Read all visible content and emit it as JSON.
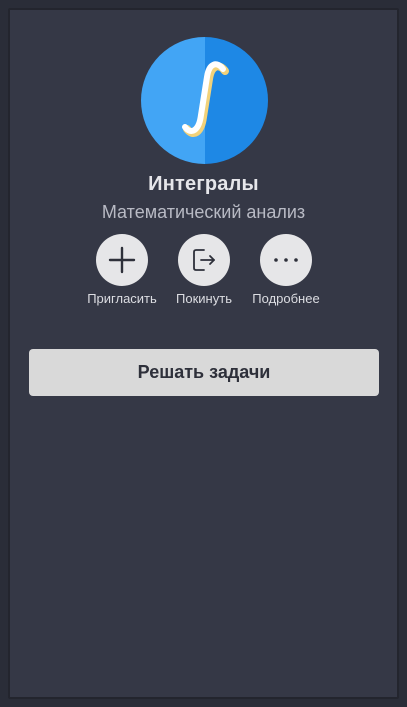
{
  "course": {
    "title": "Интегралы",
    "subtitle": "Математический анализ",
    "logo_icon": "integral-icon",
    "logo_colors": {
      "light": "#42a5f5",
      "dark": "#1e88e5",
      "symbol": "#ffffff",
      "symbol_shadow": "#f2d27a"
    }
  },
  "actions": [
    {
      "label": "Пригласить",
      "icon": "plus-icon"
    },
    {
      "label": "Покинуть",
      "icon": "exit-icon"
    },
    {
      "label": "Подробнее",
      "icon": "more-dots-icon"
    }
  ],
  "primary_button": {
    "label": "Решать задачи"
  },
  "colors": {
    "background": "#353846",
    "button": "#d9d9d9",
    "action_circle": "#e6e6e8"
  }
}
